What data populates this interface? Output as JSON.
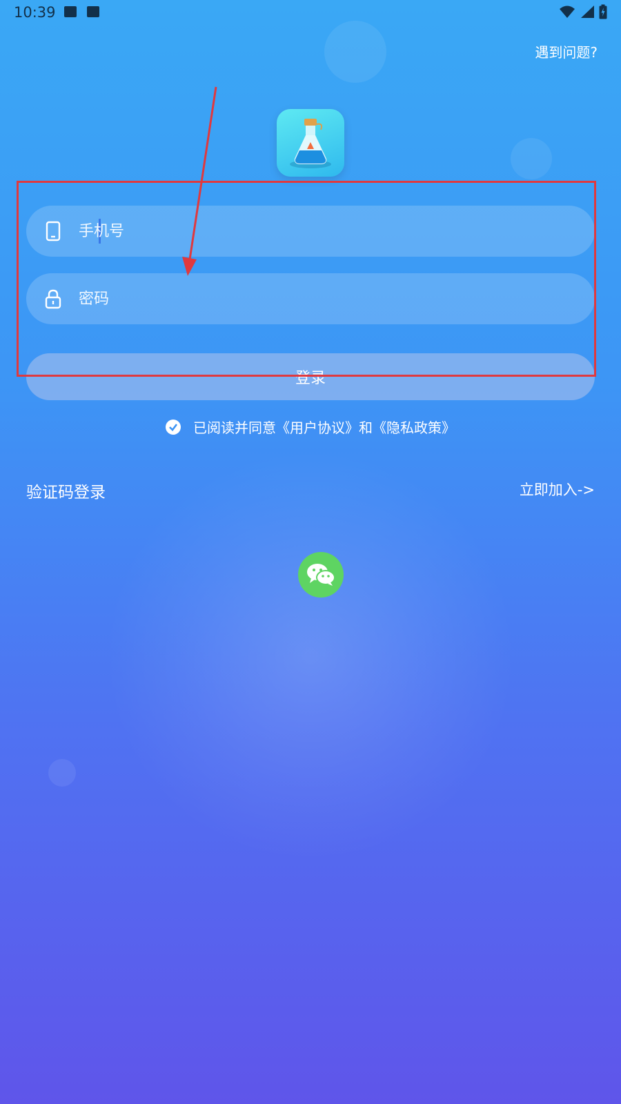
{
  "status_bar": {
    "time": "10:39",
    "left_icons": [
      "image-icon",
      "text-app-icon"
    ],
    "right_icons": [
      "wifi-icon",
      "signal-icon",
      "battery-icon"
    ]
  },
  "header": {
    "help_link": "遇到问题?"
  },
  "logo": {
    "icon": "potion-bottle-logo-icon"
  },
  "form": {
    "phone_placeholder": "手机号",
    "phone_icon": "phone-icon",
    "password_placeholder": "密码",
    "password_icon": "lock-icon",
    "login_button": "登录"
  },
  "agreement": {
    "checked": true,
    "text": "已阅读并同意《用户协议》和《隐私政策》"
  },
  "links": {
    "sms_login": "验证码登录",
    "join": "立即加入->"
  },
  "social": {
    "wechat_icon": "wechat-icon"
  },
  "colors": {
    "background_top": "#3aa8f5",
    "background_bottom": "#5f55ea",
    "annotation": "#e0393e",
    "wechat": "#5ed462"
  }
}
